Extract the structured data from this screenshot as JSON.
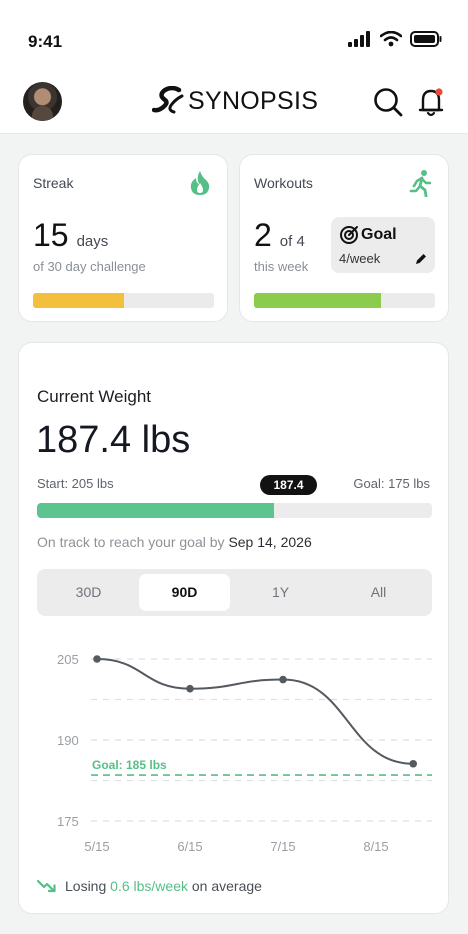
{
  "status": {
    "time": "9:41"
  },
  "brand": {
    "name": "SYNOPSIS"
  },
  "colors": {
    "green": "#56bf86",
    "yellow": "#f2c03d",
    "lime": "#8ccc4d",
    "ink": "#141821"
  },
  "streak": {
    "title": "Streak",
    "value": "15",
    "unit": "days",
    "subtitle": "of 30 day challenge",
    "progress": 0.5,
    "icon": "flame-icon"
  },
  "workouts": {
    "title": "Workouts",
    "value": "2",
    "of_label": "of 4",
    "subtitle": "this week",
    "progress": 0.7,
    "goal_label": "Goal",
    "goal_value": "4/week",
    "icon": "running-person-icon"
  },
  "weight": {
    "title": "Current Weight",
    "value": "187.4 lbs",
    "start_label": "Start: 205 lbs",
    "goal_label": "Goal: 175 lbs",
    "current_pill": "187.4",
    "progress": 0.6,
    "note_prefix": "On track to reach your goal by",
    "note_date": "Sep 14, 2026"
  },
  "tabs": [
    {
      "label": "30D",
      "active": false
    },
    {
      "label": "90D",
      "active": true
    },
    {
      "label": "1Y",
      "active": false
    },
    {
      "label": "All",
      "active": false
    }
  ],
  "chart_data": {
    "type": "line",
    "categories": [
      "5/15",
      "6/15",
      "7/15",
      "8/15"
    ],
    "y_ticks": [
      205,
      190,
      175
    ],
    "ylim": [
      175,
      205
    ],
    "series": [
      {
        "x": [
          0,
          1,
          2,
          3.4
        ],
        "values": [
          205.0,
          199.5,
          201.2,
          185.6
        ]
      }
    ],
    "goal_line": {
      "value": 183.5,
      "label": "Goal: 185 lbs"
    },
    "grid": true
  },
  "footer": {
    "prefix": "Losing",
    "rate": "0.6 lbs/week",
    "suffix": "on average"
  }
}
